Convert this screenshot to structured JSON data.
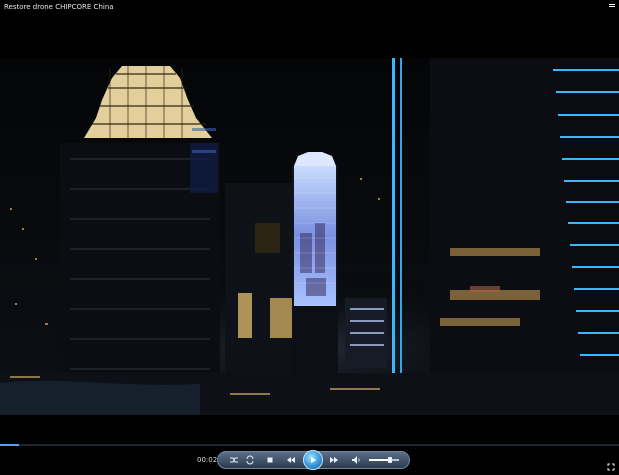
{
  "window": {
    "title": "Restore drone CHIPCORE China"
  },
  "player": {
    "time": "00:02",
    "progress": 0.03,
    "volume": 0.7
  },
  "icons": {
    "window_menu": "menu-icon",
    "shuffle": "shuffle-icon",
    "repeat": "repeat-icon",
    "stop": "stop-icon",
    "previous": "previous-icon",
    "play": "play-icon",
    "next": "next-icon",
    "volume": "volume-icon",
    "fullscreen": "fullscreen-icon"
  },
  "colors": {
    "accent": "#4aa3ff",
    "neon": "#3ab8ff"
  }
}
